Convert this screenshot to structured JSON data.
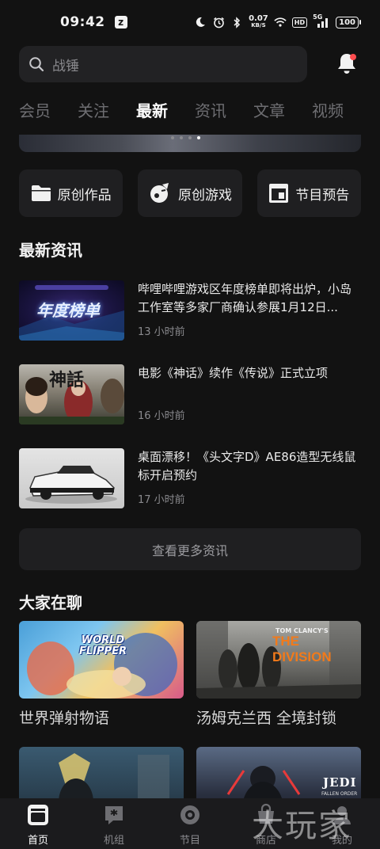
{
  "status_bar": {
    "time": "09:42",
    "app_badge": "z",
    "net_speed": "0.07",
    "net_unit": "KB/S",
    "hd": "HD",
    "network": "5G",
    "battery": "100"
  },
  "header": {
    "search_placeholder": "战锤",
    "has_notification": true
  },
  "tabs": [
    {
      "label": "会员",
      "active": false
    },
    {
      "label": "关注",
      "active": false
    },
    {
      "label": "最新",
      "active": true
    },
    {
      "label": "资讯",
      "active": false
    },
    {
      "label": "文章",
      "active": false
    },
    {
      "label": "视频",
      "active": false
    }
  ],
  "quick_buttons": [
    {
      "label": "原创作品",
      "icon": "folder-icon"
    },
    {
      "label": "原创游戏",
      "icon": "game-controller-icon"
    },
    {
      "label": "节目预告",
      "icon": "schedule-icon"
    }
  ],
  "news_section": {
    "title": "最新资讯",
    "items": [
      {
        "title": "哔哩哔哩游戏区年度榜单即将出炉，小岛工作室等多家厂商确认参展1月12日...",
        "time": "13 小时前",
        "thumb_text": "年度榜单"
      },
      {
        "title": "电影《神话》续作《传说》正式立项",
        "time": "16 小时前",
        "thumb_text": "神話"
      },
      {
        "title": "桌面漂移！《头文字D》AE86造型无线鼠标开启预约",
        "time": "17 小时前",
        "thumb_text": ""
      }
    ],
    "more_label": "查看更多资讯"
  },
  "community_section": {
    "title": "大家在聊",
    "cards": [
      {
        "label": "世界弹射物语",
        "logo": "WORLD FLIPPER"
      },
      {
        "label": "汤姆克兰西 全境封锁",
        "logo": "THE DIVISION",
        "logo_sub": "TOM CLANCY'S"
      },
      {
        "label": "",
        "logo": ""
      },
      {
        "label": "",
        "logo": "JEDI",
        "logo_sub": "FALLEN ORDER"
      }
    ]
  },
  "bottom_nav": [
    {
      "label": "首页",
      "icon": "home-icon",
      "active": true
    },
    {
      "label": "机组",
      "icon": "group-icon",
      "active": false
    },
    {
      "label": "节目",
      "icon": "program-icon",
      "active": false
    },
    {
      "label": "商店",
      "icon": "store-icon",
      "active": false
    },
    {
      "label": "我的",
      "icon": "profile-icon",
      "active": false
    }
  ],
  "watermark": "大玩家",
  "colors": {
    "background": "#121212",
    "surface": "#1f1f21",
    "text_primary": "#f2f2f2",
    "text_secondary": "#8a8a8e",
    "notification_dot": "#ff4d4f"
  }
}
